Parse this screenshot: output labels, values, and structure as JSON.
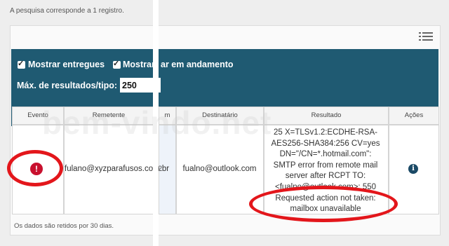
{
  "status": {
    "records_count": "A pesquisa corresponde a 1 registro.",
    "retention_note": "Os dados são retidos por 30 dias."
  },
  "filters": {
    "show_delivered": {
      "label": "Mostrar entregues",
      "checked": true
    },
    "show_pending": {
      "label": "Mostrar",
      "label_end": "ar em andamento",
      "checked": true
    },
    "max_results_label": "Máx. de resultados/tipo:",
    "max_results_value": "250"
  },
  "table": {
    "columns": [
      "Evento",
      "Remetente",
      "m",
      "Destinatário",
      "Resultado",
      "Ações"
    ],
    "rows": [
      {
        "event_icon": "error-icon",
        "sender": "fulano@xyzparafusos.com.br",
        "partial_col": "2",
        "recipient": "fualno@outlook.com",
        "result": "25 X=TLSv1.2:ECDHE-RSA-\nAES256-SHA384:256 CV=yes\nDN=\"/CN=*.hotmail.com\":\nSMTP error from remote mail\nserver after RCPT TO:\n<fualno@outlook.com>: 550\nRequested action not taken:\nmailbox unavailable",
        "action_icon": "info-icon"
      }
    ]
  },
  "watermark": "bem-vindo.net",
  "colors": {
    "filter_bar": "#1f5a72",
    "highlight_ring": "#e3161b",
    "error": "#c8102e",
    "info": "#1b4a66"
  }
}
